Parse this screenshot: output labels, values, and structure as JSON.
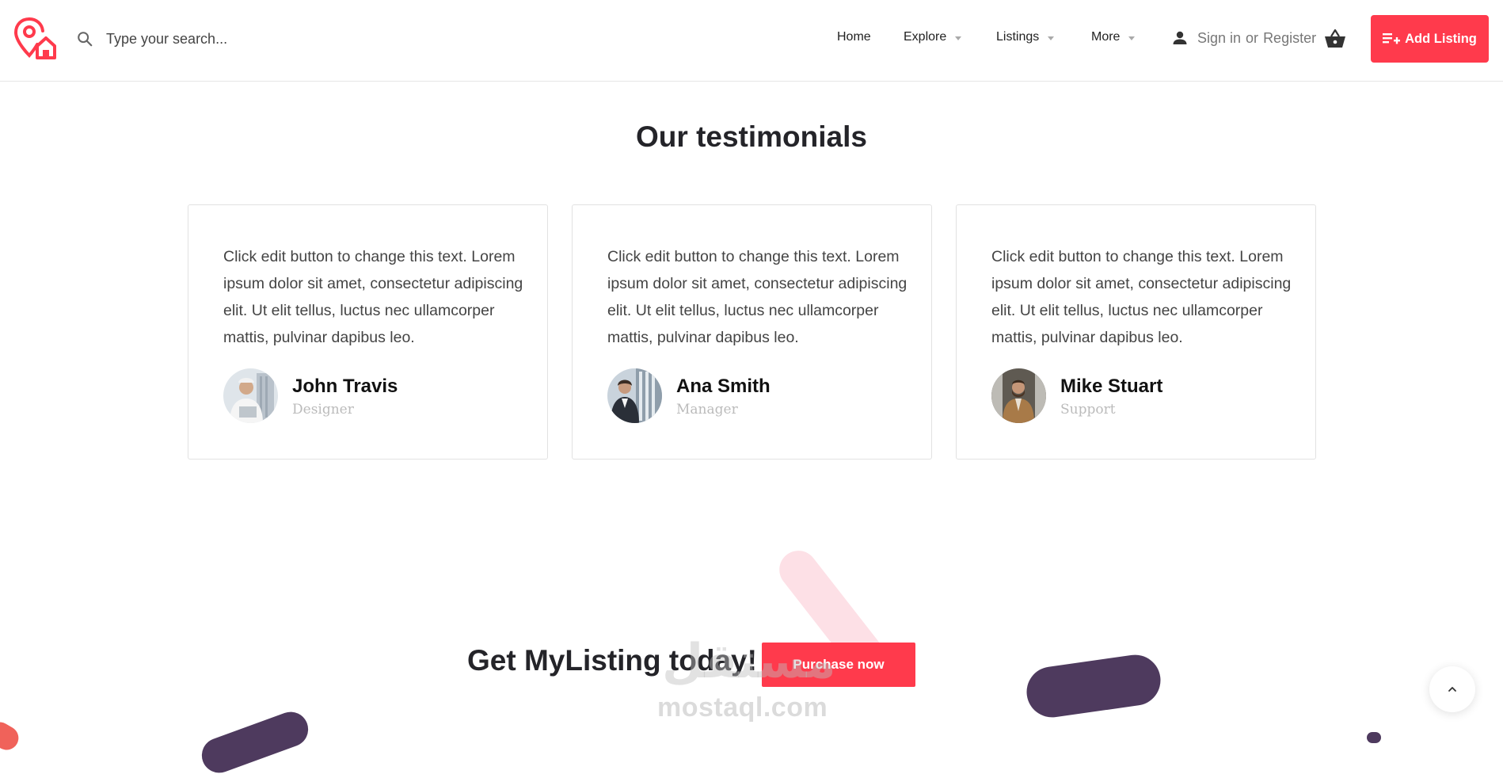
{
  "header": {
    "search_placeholder": "Type your search...",
    "nav": [
      {
        "label": "Home",
        "has_dropdown": false
      },
      {
        "label": "Explore",
        "has_dropdown": true
      },
      {
        "label": "Listings",
        "has_dropdown": true
      },
      {
        "label": "More",
        "has_dropdown": true
      }
    ],
    "signin_label": "Sign in",
    "or_label": "or",
    "register_label": "Register",
    "add_listing_label": "Add Listing",
    "icons": [
      "logo-pin-home-icon",
      "search-icon",
      "user-icon",
      "basket-icon",
      "add-list-icon"
    ]
  },
  "testimonials": {
    "title": "Our testimonials",
    "items": [
      {
        "quote": "Click edit button to change this text. Lorem ipsum dolor sit amet, consectetur adipiscing elit. Ut elit tellus, luctus nec ullamcorper mattis, pulvinar dapibus leo.",
        "name": "John Travis",
        "role": "Designer"
      },
      {
        "quote": "Click edit button to change this text. Lorem ipsum dolor sit amet, consectetur adipiscing elit. Ut elit tellus, luctus nec ullamcorper mattis, pulvinar dapibus leo.",
        "name": "Ana Smith",
        "role": "Manager"
      },
      {
        "quote": "Click edit button to change this text. Lorem ipsum dolor sit amet, consectetur adipiscing elit. Ut elit tellus, luctus nec ullamcorper mattis, pulvinar dapibus leo.",
        "name": "Mike Stuart",
        "role": "Support"
      }
    ]
  },
  "cta": {
    "title": "Get MyListing today!",
    "button_label": "Purchase now"
  },
  "watermark": {
    "arabic": "مستقل",
    "latin": "mostaql.com"
  },
  "colors": {
    "accent": "#ff3a4c",
    "dark_shape": "#4e3a5e",
    "pink_shape": "#fde0e6",
    "heading": "#242429"
  }
}
